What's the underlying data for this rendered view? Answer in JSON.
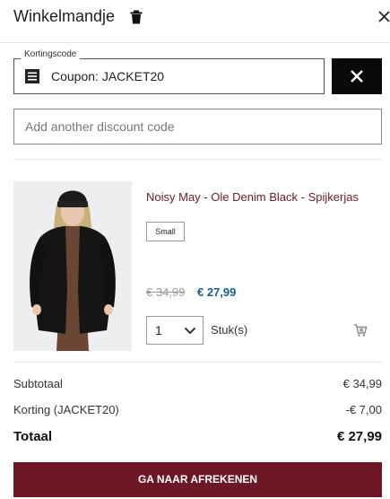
{
  "header": {
    "title": "Winkelmandje",
    "trash_icon": "trash-icon",
    "close_icon": "close-icon"
  },
  "coupon": {
    "legend": "Kortingscode",
    "applied": "Coupon: JACKET20",
    "icon": "receipt-icon",
    "remove_icon": "close-icon"
  },
  "discount": {
    "placeholder": "Add another discount code"
  },
  "item": {
    "name": "Noisy May - Ole Denim Black - Spijkerjas",
    "size": "Small",
    "old_price": "€ 34,99",
    "new_price": "€ 27,99",
    "quantity": "1",
    "unit": "Stuk(s)",
    "remove_icon": "remove-from-cart-icon"
  },
  "summary": {
    "subtotal_label": "Subtotaal",
    "subtotal_value": "€ 34,99",
    "discount_label": "Korting (JACKET20)",
    "discount_value": "-€ 7,00",
    "total_label": "Totaal",
    "total_value": "€ 27,99"
  },
  "checkout": {
    "label": "GA NAAR AFREKENEN"
  },
  "colors": {
    "brand": "#6d1725",
    "link": "#6d1a25",
    "sale_price": "#1a5f8c",
    "dark_button": "#0a0a0a"
  }
}
